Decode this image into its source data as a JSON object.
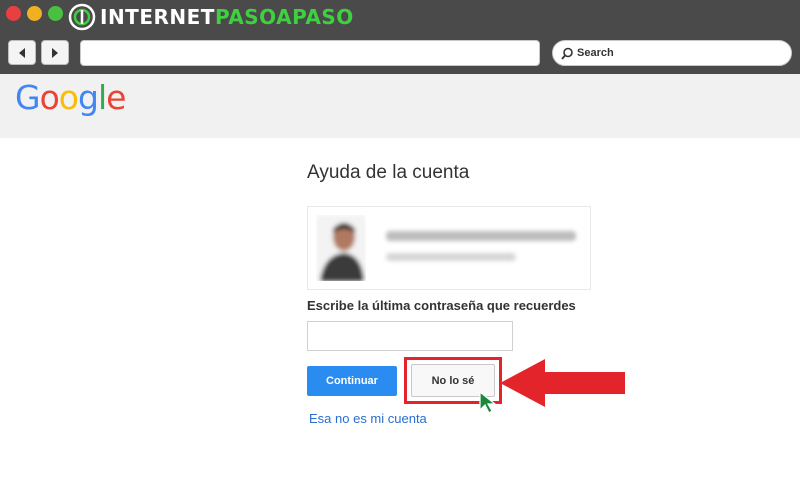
{
  "window": {
    "brand_text_a": "INTERNET",
    "brand_text_b": "PASOAPASO",
    "traffic_colors": {
      "close": "#e84040",
      "minimize": "#f0b020",
      "zoom": "#4ac040"
    },
    "brand_accent": "#3fd040"
  },
  "toolbar": {
    "back_icon": "back-arrow-icon",
    "forward_icon": "forward-arrow-icon",
    "url": "",
    "search_placeholder": "Search"
  },
  "page": {
    "logo_letters": [
      "G",
      "o",
      "o",
      "g",
      "l",
      "e"
    ],
    "title": "Ayuda de la cuenta",
    "password_prompt": "Escribe la última contraseña que recuerdes",
    "password_value": "",
    "continue_label": "Continuar",
    "dont_know_label": "No lo sé",
    "not_my_account_link": "Esa no es mi cuenta",
    "colors": {
      "primary_button": "#2a8cf0",
      "link": "#2a6fd0",
      "highlight": "#e3242b"
    }
  }
}
